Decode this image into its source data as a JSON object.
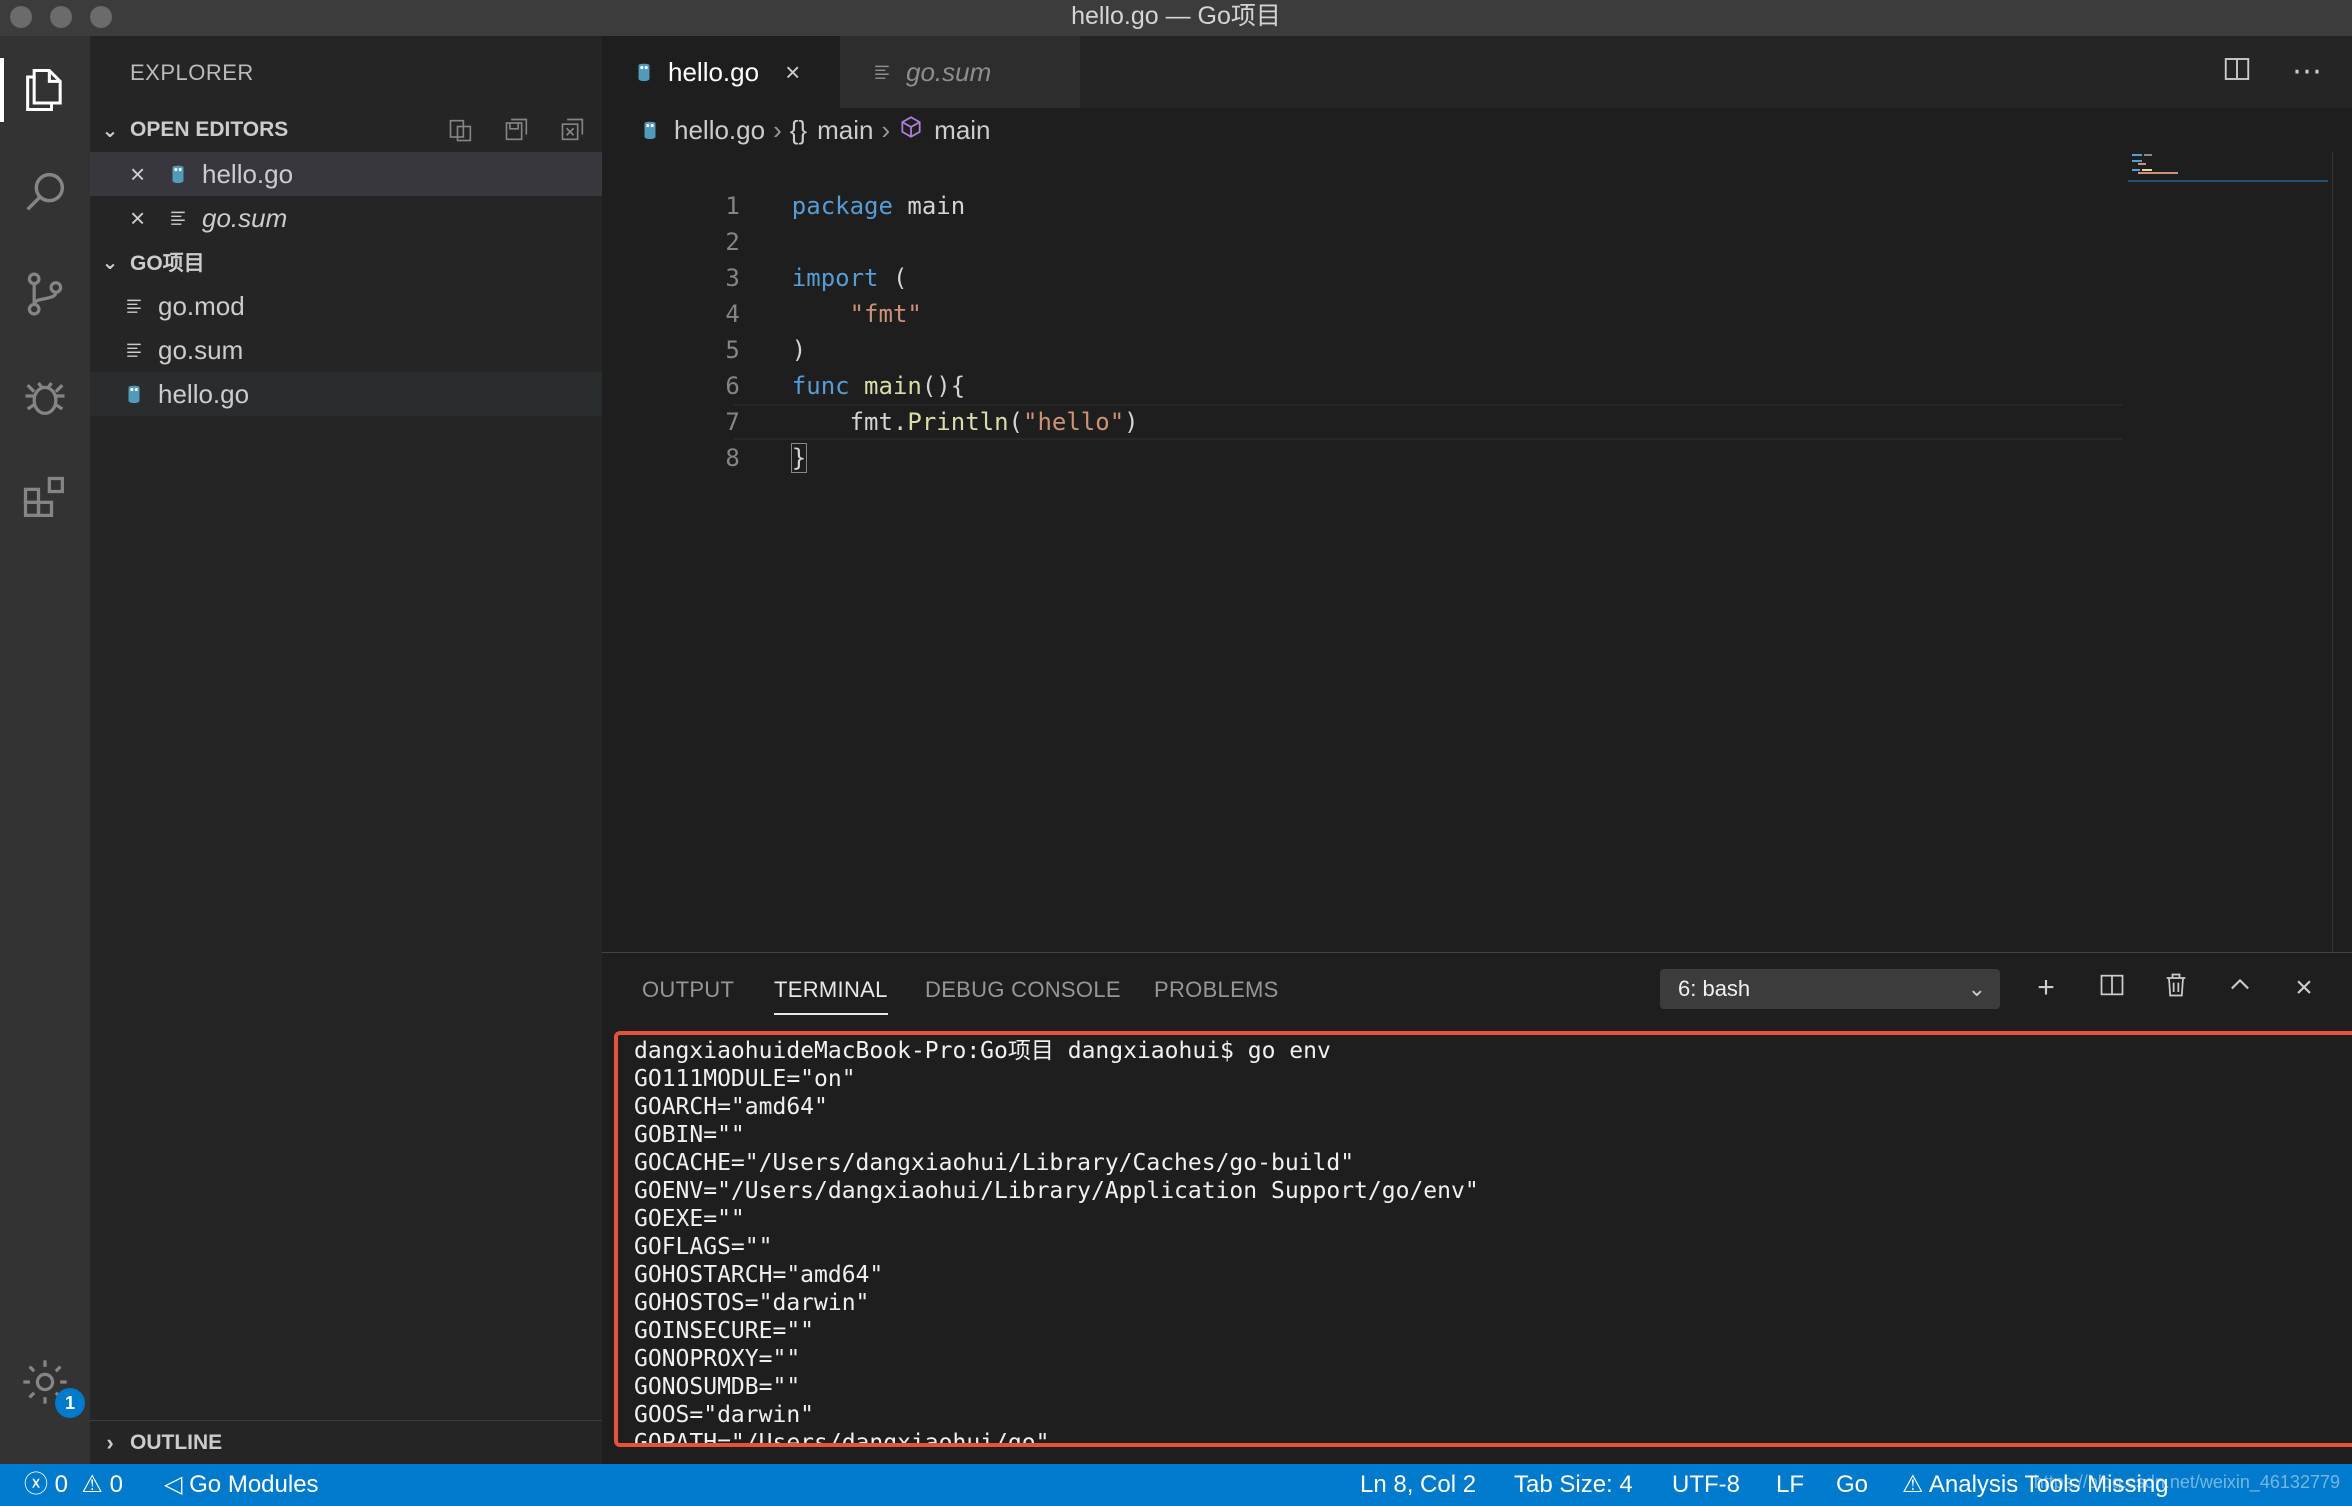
{
  "window": {
    "title": "hello.go — Go项目"
  },
  "activity_bar": {
    "settings_badge": "1"
  },
  "sidebar": {
    "title": "EXPLORER",
    "open_editors": {
      "header": "OPEN EDITORS",
      "items": [
        {
          "label": "hello.go"
        },
        {
          "label": "go.sum"
        }
      ]
    },
    "folder": {
      "header": "GO项目",
      "items": [
        {
          "label": "go.mod"
        },
        {
          "label": "go.sum"
        },
        {
          "label": "hello.go"
        }
      ]
    },
    "outline": "OUTLINE"
  },
  "tabs": [
    {
      "label": "hello.go"
    },
    {
      "label": "go.sum"
    }
  ],
  "breadcrumb": {
    "file": "hello.go",
    "scope1": "main",
    "scope2": "main"
  },
  "code": {
    "line_numbers": [
      "1",
      "2",
      "3",
      "4",
      "5",
      "6",
      "7",
      "8"
    ],
    "l1_kw": "package",
    "l1_id": "main",
    "l3_kw": "import",
    "l3_rest": "(",
    "l4_str": "\"fmt\"",
    "l5": ")",
    "l6_kw": "func",
    "l6_fn": "main",
    "l6_rest": "(){",
    "l7_pkg": "fmt.",
    "l7_fn": "Println",
    "l7_open": "(",
    "l7_str": "\"hello\"",
    "l7_close": ")",
    "l8": "}"
  },
  "panel": {
    "tabs": [
      "OUTPUT",
      "TERMINAL",
      "DEBUG CONSOLE",
      "PROBLEMS"
    ],
    "terminal_select": "6: bash",
    "terminal_lines": [
      "dangxiaohuideMacBook-Pro:Go项目 dangxiaohui$ go env",
      "GO111MODULE=\"on\"",
      "GOARCH=\"amd64\"",
      "GOBIN=\"\"",
      "GOCACHE=\"/Users/dangxiaohui/Library/Caches/go-build\"",
      "GOENV=\"/Users/dangxiaohui/Library/Application Support/go/env\"",
      "GOEXE=\"\"",
      "GOFLAGS=\"\"",
      "GOHOSTARCH=\"amd64\"",
      "GOHOSTOS=\"darwin\"",
      "GOINSECURE=\"\"",
      "GONOPROXY=\"\"",
      "GONOSUMDB=\"\"",
      "GOOS=\"darwin\"",
      "GOPATH=\"/Users/dangxiaohui/go\""
    ]
  },
  "status_bar": {
    "errors": "0",
    "warnings": "0",
    "go_modules": "Go Modules",
    "position": "Ln 8, Col 2",
    "tab_size": "Tab Size: 4",
    "encoding": "UTF-8",
    "eol": "LF",
    "language": "Go",
    "analysis": "Analysis Tools Missing",
    "watermark": "https://blog.csdn.net/weixin_46132779"
  },
  "colors": {
    "accent": "#007acc",
    "highlight_frame": "#e5533c",
    "keyword": "#569cd6",
    "string": "#ce9178",
    "function": "#dcdcaa"
  }
}
